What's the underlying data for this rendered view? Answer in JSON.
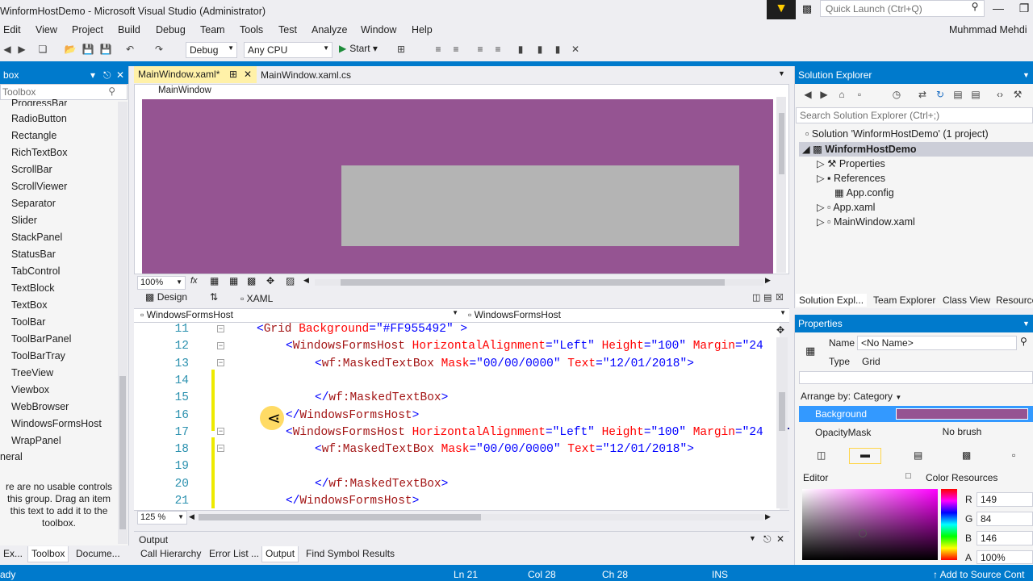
{
  "window": {
    "title": "WinformHostDemo - Microsoft Visual Studio (Administrator)",
    "quick_launch_placeholder": "Quick Launch (Ctrl+Q)",
    "user": "Muhmmad Mehdi"
  },
  "menu": [
    "Edit",
    "View",
    "Project",
    "Build",
    "Debug",
    "Team",
    "Tools",
    "Test",
    "Analyze",
    "Window",
    "Help"
  ],
  "toolbar": {
    "config": "Debug",
    "platform": "Any CPU",
    "start": "Start"
  },
  "toolbox": {
    "title": "box",
    "search_placeholder": "Toolbox",
    "partial_top": "ProgressBar",
    "items": [
      "RadioButton",
      "Rectangle",
      "RichTextBox",
      "ScrollBar",
      "ScrollViewer",
      "Separator",
      "Slider",
      "StackPanel",
      "StatusBar",
      "TabControl",
      "TextBlock",
      "TextBox",
      "ToolBar",
      "ToolBarPanel",
      "ToolBarTray",
      "TreeView",
      "Viewbox",
      "WebBrowser",
      "WindowsFormsHost",
      "WrapPanel"
    ],
    "group_general": "neral",
    "empty_message": [
      "re are no usable controls",
      "this group. Drag an item",
      "this text to add it to the",
      "toolbox."
    ],
    "bottom_tabs": [
      "Ex...",
      "Toolbox",
      "Docume..."
    ]
  },
  "editor": {
    "tabs": [
      {
        "label": "MainWindow.xaml*",
        "active": true
      },
      {
        "label": "MainWindow.xaml.cs",
        "active": false
      }
    ],
    "designer_window_label": "MainWindow",
    "design_zoom": "100%",
    "design_tab": "Design",
    "xaml_tab": "XAML",
    "nav_left": "WindowsFormsHost",
    "nav_right": "WindowsFormsHost",
    "code_zoom": "125 %",
    "lines": [
      {
        "n": "11",
        "indent": 0,
        "kind": "grid",
        "text": "<Grid Background=\"#FF955492\" >"
      },
      {
        "n": "12",
        "indent": 1,
        "kind": "wfh-open",
        "text": "<WindowsFormsHost HorizontalAlignment=\"Left\" Height=\"100\" Margin=\"24"
      },
      {
        "n": "13",
        "indent": 2,
        "kind": "mtb-open",
        "text": "<wf:MaskedTextBox Mask=\"00/00/0000\" Text=\"12/01/2018\">"
      },
      {
        "n": "14",
        "indent": 0,
        "kind": "blank",
        "text": ""
      },
      {
        "n": "15",
        "indent": 2,
        "kind": "close",
        "text": "</wf:MaskedTextBox>"
      },
      {
        "n": "16",
        "indent": 1,
        "kind": "close",
        "text": "</WindowsFormsHost>"
      },
      {
        "n": "17",
        "indent": 1,
        "kind": "wfh-open",
        "text": "<WindowsFormsHost HorizontalAlignment=\"Left\" Height=\"100\" Margin=\"24"
      },
      {
        "n": "18",
        "indent": 2,
        "kind": "mtb-open",
        "text": "<wf:MaskedTextBox Mask=\"00/00/0000\" Text=\"12/01/2018\">"
      },
      {
        "n": "19",
        "indent": 0,
        "kind": "blank",
        "text": ""
      },
      {
        "n": "20",
        "indent": 2,
        "kind": "close",
        "text": "</wf:MaskedTextBox>"
      },
      {
        "n": "21",
        "indent": 1,
        "kind": "close",
        "text": "</WindowsFormsHost>"
      }
    ]
  },
  "output": {
    "title": "Output",
    "tabs": [
      "Call Hierarchy",
      "Error List ...",
      "Output",
      "Find Symbol Results"
    ]
  },
  "solution_explorer": {
    "title": "Solution Explorer",
    "search_placeholder": "Search Solution Explorer (Ctrl+;)",
    "solution": "Solution 'WinformHostDemo' (1 project)",
    "project": "WinformHostDemo",
    "items": [
      "Properties",
      "References",
      "App.config",
      "App.xaml",
      "MainWindow.xaml"
    ],
    "tabs": [
      "Solution Expl...",
      "Team Explorer",
      "Class View",
      "Resource"
    ]
  },
  "properties": {
    "title": "Properties",
    "name_label": "Name",
    "name_value": "<No Name>",
    "type_label": "Type",
    "type_value": "Grid",
    "arrange": "Arrange by: Category",
    "background_label": "Background",
    "background_color": "#955492",
    "opacity_label": "OpacityMask",
    "opacity_value": "No brush",
    "editor_label": "Editor",
    "color_resources": "Color Resources",
    "r": "149",
    "g": "84",
    "b": "146",
    "a": "100%"
  },
  "status": {
    "left": "ady",
    "ln": "Ln 21",
    "col": "Col 28",
    "ch": "Ch 28",
    "mode": "INS",
    "source": "Add to Source Cont"
  }
}
